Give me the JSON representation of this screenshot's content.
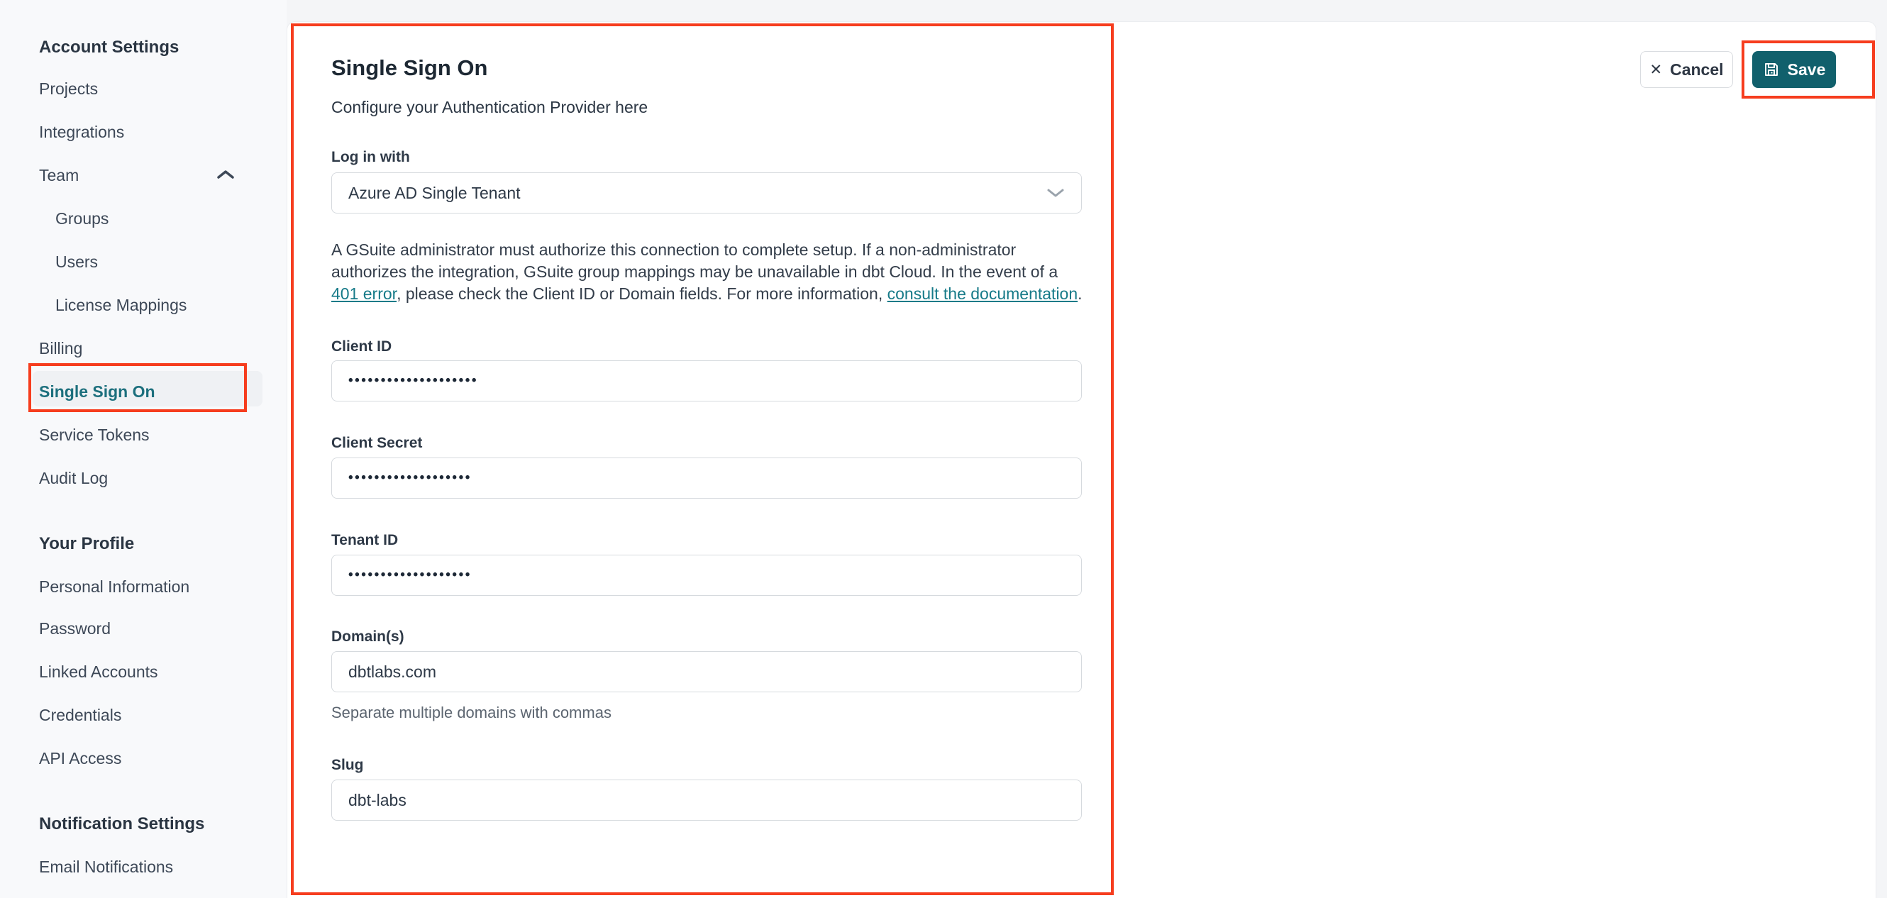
{
  "sidebar": {
    "section_account": "Account Settings",
    "section_profile": "Your Profile",
    "section_notifications": "Notification Settings",
    "items": {
      "projects": "Projects",
      "integrations": "Integrations",
      "team": "Team",
      "groups": "Groups",
      "users": "Users",
      "license_mappings": "License Mappings",
      "billing": "Billing",
      "single_sign_on": "Single Sign On",
      "service_tokens": "Service Tokens",
      "audit_log": "Audit Log",
      "personal_information": "Personal Information",
      "password": "Password",
      "linked_accounts": "Linked Accounts",
      "credentials": "Credentials",
      "api_access": "API Access",
      "email_notifications": "Email Notifications"
    }
  },
  "toolbar": {
    "cancel_label": "Cancel",
    "save_label": "Save"
  },
  "main": {
    "title": "Single Sign On",
    "subtitle": "Configure your Authentication Provider here",
    "login_with": {
      "label": "Log in with",
      "value": "Azure AD Single Tenant"
    },
    "notice": {
      "part1": "A GSuite administrator must authorize this connection to complete setup. If a non-administrator authorizes the integration, GSuite group mappings may be unavailable in dbt Cloud. In the event of a ",
      "link1": "401 error",
      "part2": ", please check the Client ID or Domain fields. For more information, ",
      "link2": "consult the documentation",
      "part3": "."
    },
    "fields": {
      "client_id": {
        "label": "Client ID",
        "value": "••••••••••••••••••••"
      },
      "client_secret": {
        "label": "Client Secret",
        "value": "•••••••••••••••••••"
      },
      "tenant_id": {
        "label": "Tenant ID",
        "value": "•••••••••••••••••••"
      },
      "domains": {
        "label": "Domain(s)",
        "value": "dbtlabs.com",
        "helper": "Separate multiple domains with commas"
      },
      "slug": {
        "label": "Slug",
        "value": "dbt-labs"
      }
    }
  },
  "colors": {
    "accent_teal": "#11606c",
    "active_nav_teal": "#1c6f7d",
    "link_teal": "#167a88",
    "annotation_red": "#f63d1e"
  }
}
